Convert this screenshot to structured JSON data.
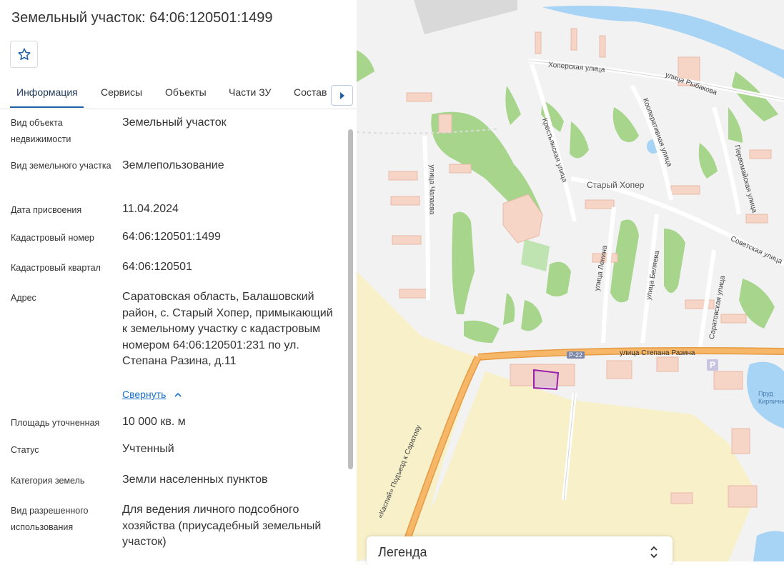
{
  "header": {
    "title": "Земельный участок: 64:06:120501:1499"
  },
  "tabs": [
    {
      "label": "Информация",
      "active": true
    },
    {
      "label": "Сервисы"
    },
    {
      "label": "Объекты"
    },
    {
      "label": "Части ЗУ"
    },
    {
      "label": "Состав"
    }
  ],
  "info": {
    "object_type": {
      "label": "Вид объекта недвижимости",
      "value": "Земельный участок"
    },
    "land_type": {
      "label": "Вид земельного участка",
      "value": "Землепользование"
    },
    "assigned_date": {
      "label": "Дата присвоения",
      "value": "11.04.2024"
    },
    "cadastral_number": {
      "label": "Кадастровый номер",
      "value": "64:06:120501:1499"
    },
    "cadastral_block": {
      "label": "Кадастровый квартал",
      "value": "64:06:120501"
    },
    "address": {
      "label": "Адрес",
      "value": "Саратовская область, Балашовский район, с. Старый Хопер, примыкающий к земельному участку с кадастровым номером 64:06:120501:231 по ул. Степана Разина, д.11",
      "collapse_label": "Свернуть"
    },
    "area": {
      "label": "Площадь уточненная",
      "value": "10 000 кв. м"
    },
    "status": {
      "label": "Статус",
      "value": "Учтенный"
    },
    "land_category": {
      "label": "Категория земель",
      "value": "Земли населенных пунктов"
    },
    "permitted_use": {
      "label": "Вид разрешенного использования",
      "value": "Для ведения личного подсобного хозяйства (приусадебный земельный участок)"
    }
  },
  "map": {
    "labels": {
      "khoperskaya": "Хоперская улица",
      "rybakova": "улица Рыбакова",
      "kooperativnaya": "Кооперативная улица",
      "krestyanskaya": "Крестьянская улица",
      "pervomayskaya": "Первомайская улица",
      "chapaeva": "улица Чапаева",
      "village": "Старый Хопер",
      "sovetskaya": "Советская улица",
      "lenina": "улица Ленина",
      "belyaeva": "улица Беляева",
      "saratovskaya": "Саратовская улица",
      "razina": "улица Степана Разина",
      "road_badge": "Р-22",
      "kaspiy": "«Каспий» Подъезд к Саратову",
      "pond": "Пруд Кирпичный",
      "parking": "P"
    }
  },
  "legend": {
    "title": "Легенда"
  },
  "colors": {
    "accent": "#1e5fa8",
    "link": "#1a73c9",
    "parcel_outline": "#9b1fa8",
    "highway": "#f0a34a",
    "water": "#a7d3f5",
    "green": "#a7d58c",
    "building": "#f6d5c6"
  }
}
